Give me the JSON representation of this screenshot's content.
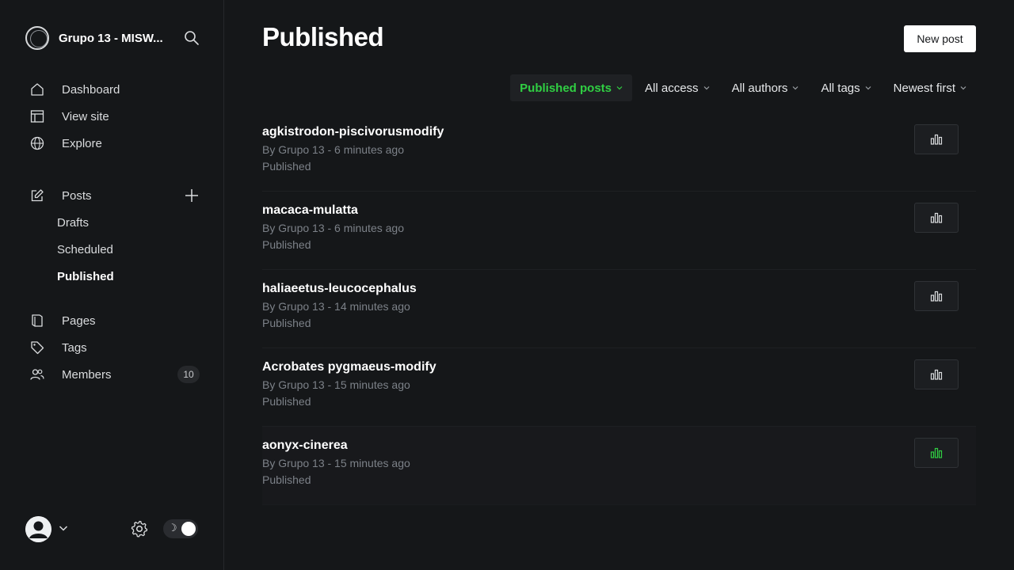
{
  "brand": {
    "title": "Grupo 13 - MISW..."
  },
  "nav": {
    "primary": [
      {
        "label": "Dashboard",
        "icon": "house-icon"
      },
      {
        "label": "View site",
        "icon": "browser-icon"
      },
      {
        "label": "Explore",
        "icon": "globe-icon"
      }
    ],
    "posts": {
      "label": "Posts",
      "icon": "edit-icon"
    },
    "post_subitems": [
      {
        "label": "Drafts"
      },
      {
        "label": "Scheduled"
      },
      {
        "label": "Published",
        "active": true
      }
    ],
    "secondary": [
      {
        "label": "Pages",
        "icon": "pages-icon"
      },
      {
        "label": "Tags",
        "icon": "tag-icon"
      },
      {
        "label": "Members",
        "icon": "members-icon",
        "badge": "10"
      }
    ]
  },
  "header": {
    "title": "Published",
    "new_post_label": "New post"
  },
  "filters": [
    {
      "label": "Published posts",
      "active": true
    },
    {
      "label": "All access"
    },
    {
      "label": "All authors"
    },
    {
      "label": "All tags"
    },
    {
      "label": "Newest first"
    }
  ],
  "posts": [
    {
      "title": "agkistrodon-piscivorusmodify",
      "meta": "By Grupo 13 - 6 minutes ago",
      "status": "Published"
    },
    {
      "title": "macaca-mulatta",
      "meta": "By Grupo 13 - 6 minutes ago",
      "status": "Published"
    },
    {
      "title": "haliaeetus-leucocephalus",
      "meta": "By Grupo 13 - 14 minutes ago",
      "status": "Published"
    },
    {
      "title": "Acrobates pygmaeus-modify",
      "meta": "By Grupo 13 - 15 minutes ago",
      "status": "Published"
    },
    {
      "title": "aonyx-cinerea",
      "meta": "By Grupo 13 - 15 minutes ago",
      "status": "Published",
      "hovered": true
    }
  ],
  "colors": {
    "accent": "#30cf43",
    "background": "#151719",
    "muted_text": "#7c8188"
  }
}
